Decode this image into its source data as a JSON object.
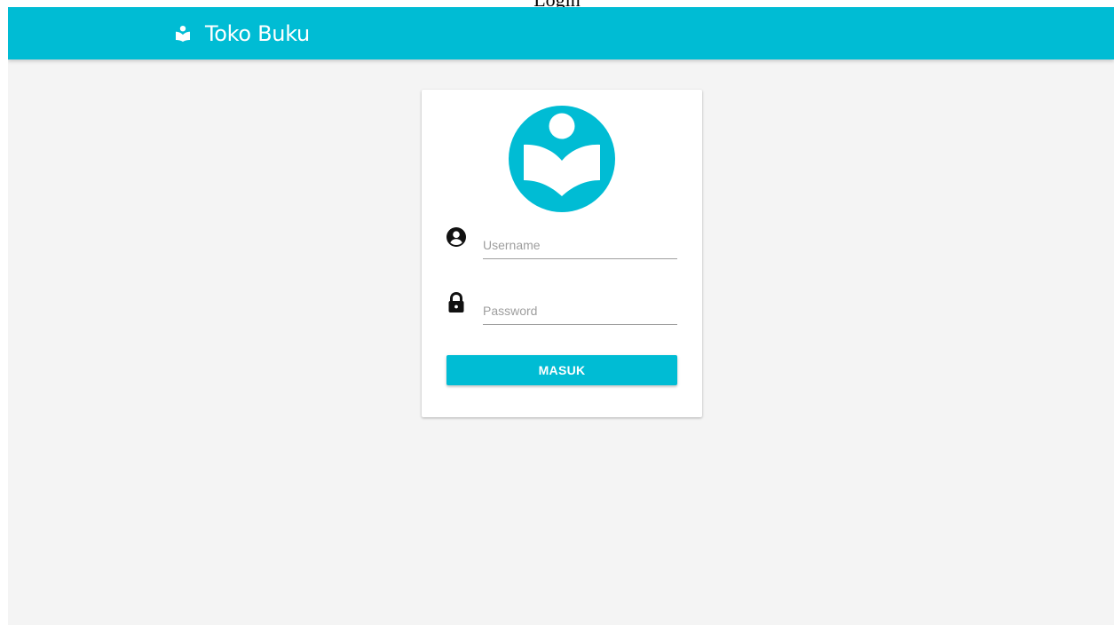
{
  "page": {
    "title": "Login"
  },
  "navbar": {
    "brand_name": "Toko Buku",
    "brand_icon": "book-reader-icon",
    "color": "#00bcd4"
  },
  "login_card": {
    "logo_icon": "book-reader-logo-icon",
    "username": {
      "icon": "user-circle-icon",
      "placeholder": "Username",
      "value": ""
    },
    "password": {
      "icon": "lock-icon",
      "placeholder": "Password",
      "value": ""
    },
    "submit_label": "MASUK"
  },
  "colors": {
    "accent": "#00bcd4",
    "background": "#f4f4f4",
    "card": "#ffffff"
  }
}
